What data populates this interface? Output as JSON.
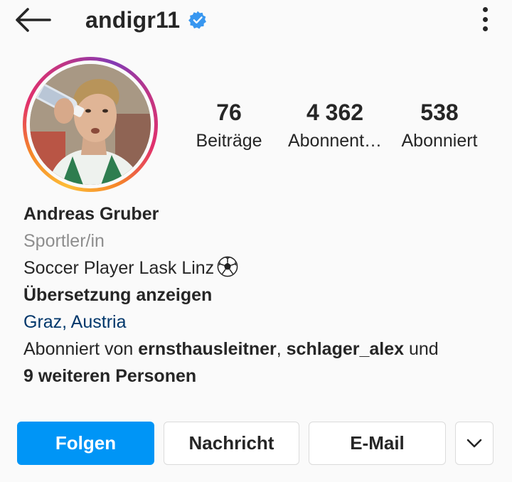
{
  "header": {
    "username": "andigr11",
    "back_icon": "arrow-left-icon",
    "verified_icon": "verified-badge-icon",
    "more_icon": "more-vertical-icon"
  },
  "stats": [
    {
      "value": "76",
      "label": "Beiträge"
    },
    {
      "value": "4 362",
      "label": "Abonnent…"
    },
    {
      "value": "538",
      "label": "Abonniert"
    }
  ],
  "bio": {
    "name": "Andreas Gruber",
    "category": "Sportler/in",
    "text": "Soccer Player  Lask Linz",
    "translate": "Übersetzung anzeigen",
    "location": "Graz, Austria",
    "followed_by_prefix": "Abonniert von ",
    "followed_by_user1": "ernsthausleitner",
    "followed_by_sep": ", ",
    "followed_by_user2": "schlager_alex",
    "followed_by_and": " und",
    "followed_by_more": "9 weiteren Personen"
  },
  "buttons": {
    "follow": "Folgen",
    "message": "Nachricht",
    "email": "E-Mail",
    "more_icon": "chevron-down-icon"
  },
  "colors": {
    "accent": "#0095f6",
    "verified": "#3897f0",
    "location": "#00376b",
    "secondary_text": "#8e8e8e"
  }
}
